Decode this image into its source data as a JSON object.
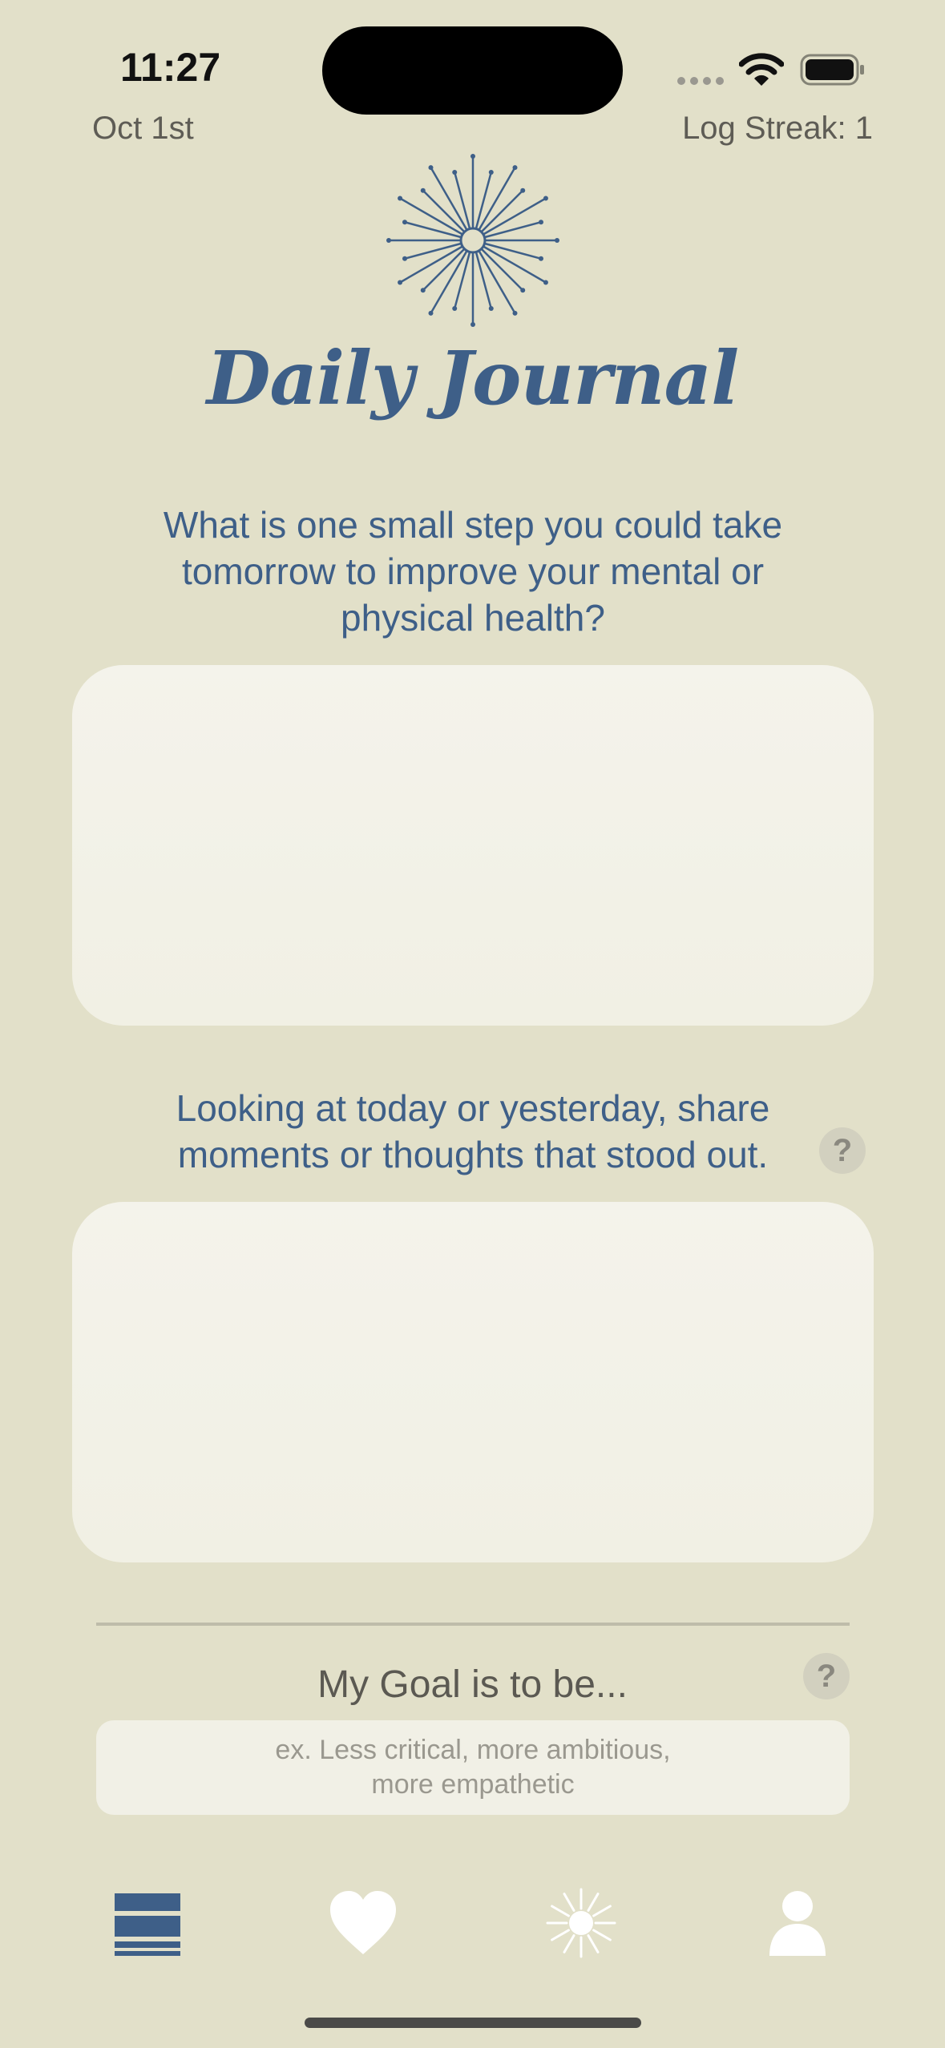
{
  "status_bar": {
    "time": "11:27"
  },
  "header": {
    "date": "Oct 1st",
    "log_streak": "Log Streak: 1"
  },
  "title": "Daily Journal",
  "prompts": [
    {
      "text": "What is one small step you could take tomorrow to improve your mental or physical health?",
      "value": ""
    },
    {
      "text": "Looking at today or yesterday, share moments or thoughts that stood out.",
      "value": ""
    }
  ],
  "help_label": "?",
  "goal": {
    "label": "My Goal is to be...",
    "placeholder_line1": "ex. Less critical, more ambitious,",
    "placeholder_line2": "more empathetic"
  },
  "tab_bar": {
    "items": [
      {
        "icon": "list-icon",
        "active": true
      },
      {
        "icon": "heart-icon",
        "active": false
      },
      {
        "icon": "sun-icon",
        "active": false
      },
      {
        "icon": "person-icon",
        "active": false
      }
    ]
  },
  "colors": {
    "background": "#e2e0c9",
    "accent": "#3e5f88",
    "entry_background": "#f4f3eb"
  }
}
